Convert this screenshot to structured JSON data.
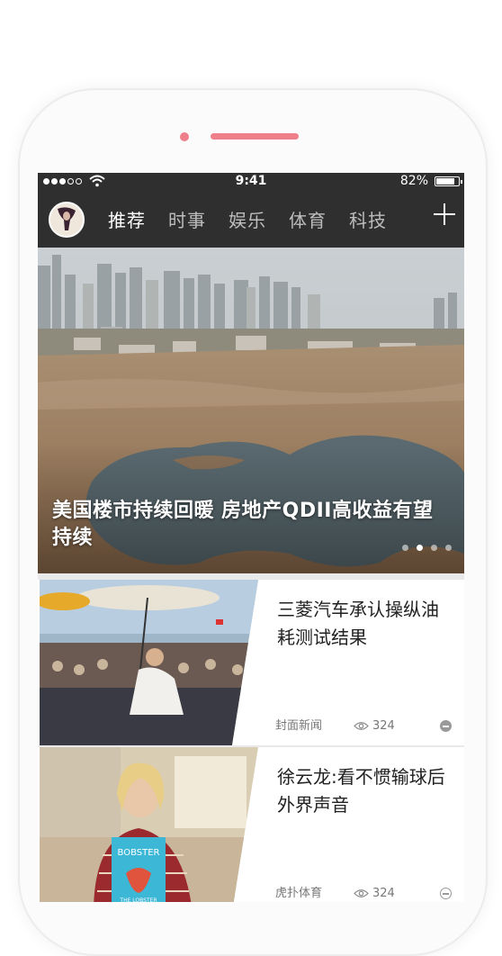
{
  "status": {
    "time": "9:41",
    "battery": "82%",
    "battery_level": 0.82
  },
  "nav": {
    "tabs": [
      {
        "label": "推荐",
        "active": true
      },
      {
        "label": "时事",
        "active": false
      },
      {
        "label": "娱乐",
        "active": false
      },
      {
        "label": "体育",
        "active": false
      },
      {
        "label": "科技",
        "active": false
      }
    ],
    "add_icon": "plus-icon"
  },
  "hero": {
    "title": "美国楼市持续回暖 房地产QDII高收益有望持续",
    "slides": 4,
    "active_slide": 2
  },
  "articles": [
    {
      "title": "三菱汽车承认操纵油耗测试结果",
      "source": "封面新闻",
      "views": "324"
    },
    {
      "title": "徐云龙:看不惯输球后外界声音",
      "source": "虎扑体育",
      "views": "324"
    }
  ],
  "colors": {
    "accent": "#f07f8c",
    "navbar": "#2f2f2f"
  }
}
